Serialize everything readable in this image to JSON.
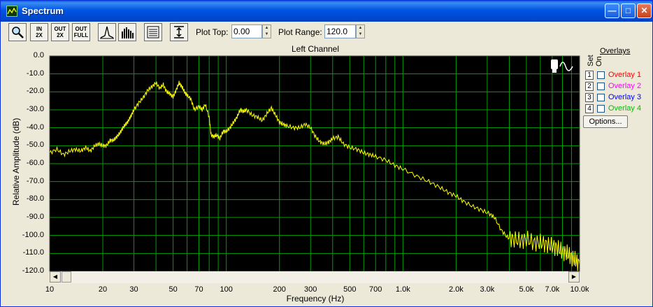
{
  "window": {
    "title": "Spectrum"
  },
  "toolbar": {
    "zoom_in_2x_top": "IN",
    "zoom_in_2x_bottom": "2X",
    "zoom_out_2x_top": "OUT",
    "zoom_out_2x_bottom": "2X",
    "zoom_out_full_top": "OUT",
    "zoom_out_full_bottom": "FULL",
    "plot_top_label": "Plot Top:",
    "plot_top_value": "0.00",
    "plot_range_label": "Plot Range:",
    "plot_range_value": "120.0"
  },
  "overlays": {
    "header": "Overlays",
    "set_label": "Set",
    "on_label": "On",
    "items": [
      {
        "num": "1",
        "name": "Overlay 1",
        "color": "#ff0000",
        "checked": false
      },
      {
        "num": "2",
        "name": "Overlay 2",
        "color": "#ff00ff",
        "checked": false
      },
      {
        "num": "3",
        "name": "Overlay 3",
        "color": "#0000ff",
        "checked": false
      },
      {
        "num": "4",
        "name": "Overlay 4",
        "color": "#00c000",
        "checked": false
      }
    ],
    "options_label": "Options..."
  },
  "colors": {
    "plot_bg": "#000000",
    "grid": "#00a000",
    "trace": "#ffff00",
    "titlebar": "#0054e3"
  },
  "chart_data": {
    "type": "line",
    "title": "Left Channel",
    "xlabel": "Frequency (Hz)",
    "ylabel": "Relative Amplitude (dB)",
    "x_scale": "log",
    "xlim": [
      10,
      10000
    ],
    "ylim": [
      -120,
      0
    ],
    "grid": true,
    "x_tick_labels": [
      {
        "value": 10,
        "label": "10"
      },
      {
        "value": 20,
        "label": "20"
      },
      {
        "value": 30,
        "label": "30"
      },
      {
        "value": 50,
        "label": "50"
      },
      {
        "value": 70,
        "label": "70"
      },
      {
        "value": 100,
        "label": "100"
      },
      {
        "value": 200,
        "label": "200"
      },
      {
        "value": 300,
        "label": "300"
      },
      {
        "value": 500,
        "label": "500"
      },
      {
        "value": 700,
        "label": "700"
      },
      {
        "value": 1000,
        "label": "1.0k"
      },
      {
        "value": 2000,
        "label": "2.0k"
      },
      {
        "value": 3000,
        "label": "3.0k"
      },
      {
        "value": 5000,
        "label": "5.0k"
      },
      {
        "value": 7000,
        "label": "7.0k"
      },
      {
        "value": 10000,
        "label": "10.0k"
      }
    ],
    "y_tick_labels": [
      {
        "value": 0,
        "label": "0.0"
      },
      {
        "value": -10,
        "label": "-10.0"
      },
      {
        "value": -20,
        "label": "-20.0"
      },
      {
        "value": -30,
        "label": "-30.0"
      },
      {
        "value": -40,
        "label": "-40.0"
      },
      {
        "value": -50,
        "label": "-50.0"
      },
      {
        "value": -60,
        "label": "-60.0"
      },
      {
        "value": -70,
        "label": "-70.0"
      },
      {
        "value": -80,
        "label": "-80.0"
      },
      {
        "value": -90,
        "label": "-90.0"
      },
      {
        "value": -100,
        "label": "-100.0"
      },
      {
        "value": -110,
        "label": "-110.0"
      },
      {
        "value": -120,
        "label": "-120.0"
      }
    ],
    "series": [
      {
        "color": "#ffff00",
        "points": [
          [
            10,
            -54
          ],
          [
            11,
            -52
          ],
          [
            12,
            -55
          ],
          [
            13,
            -53
          ],
          [
            14,
            -52
          ],
          [
            15,
            -53
          ],
          [
            16,
            -51
          ],
          [
            17,
            -53
          ],
          [
            18,
            -50
          ],
          [
            19,
            -49
          ],
          [
            20,
            -50
          ],
          [
            21,
            -50
          ],
          [
            22,
            -47
          ],
          [
            23,
            -47
          ],
          [
            24,
            -45
          ],
          [
            25,
            -43
          ],
          [
            26,
            -40
          ],
          [
            27,
            -38
          ],
          [
            28,
            -36
          ],
          [
            29,
            -33
          ],
          [
            30,
            -30
          ],
          [
            32,
            -26
          ],
          [
            34,
            -23
          ],
          [
            36,
            -19
          ],
          [
            38,
            -17
          ],
          [
            40,
            -15
          ],
          [
            42,
            -18
          ],
          [
            44,
            -16
          ],
          [
            46,
            -20
          ],
          [
            48,
            -21
          ],
          [
            50,
            -23
          ],
          [
            52,
            -19
          ],
          [
            54,
            -15
          ],
          [
            56,
            -17
          ],
          [
            58,
            -20
          ],
          [
            60,
            -22
          ],
          [
            63,
            -24
          ],
          [
            66,
            -30
          ],
          [
            70,
            -28
          ],
          [
            73,
            -30
          ],
          [
            76,
            -27
          ],
          [
            80,
            -34
          ],
          [
            82,
            -44
          ],
          [
            85,
            -45
          ],
          [
            88,
            -44
          ],
          [
            92,
            -46
          ],
          [
            96,
            -42
          ],
          [
            100,
            -42
          ],
          [
            105,
            -40
          ],
          [
            110,
            -37
          ],
          [
            115,
            -34
          ],
          [
            120,
            -30
          ],
          [
            125,
            -31
          ],
          [
            130,
            -30
          ],
          [
            140,
            -33
          ],
          [
            150,
            -34
          ],
          [
            160,
            -36
          ],
          [
            170,
            -32
          ],
          [
            180,
            -29
          ],
          [
            190,
            -33
          ],
          [
            200,
            -37
          ],
          [
            210,
            -38
          ],
          [
            220,
            -39
          ],
          [
            240,
            -40
          ],
          [
            260,
            -40
          ],
          [
            280,
            -38
          ],
          [
            300,
            -40
          ],
          [
            320,
            -45
          ],
          [
            340,
            -48
          ],
          [
            360,
            -49
          ],
          [
            380,
            -48
          ],
          [
            400,
            -46
          ],
          [
            430,
            -45
          ],
          [
            460,
            -49
          ],
          [
            500,
            -51
          ],
          [
            550,
            -52
          ],
          [
            600,
            -54
          ],
          [
            650,
            -55
          ],
          [
            700,
            -56
          ],
          [
            800,
            -58
          ],
          [
            900,
            -61
          ],
          [
            1000,
            -63
          ],
          [
            1200,
            -67
          ],
          [
            1400,
            -70
          ],
          [
            1600,
            -73
          ],
          [
            1800,
            -76
          ],
          [
            2000,
            -78
          ],
          [
            2200,
            -81
          ],
          [
            2500,
            -84
          ],
          [
            2800,
            -86
          ],
          [
            3100,
            -88
          ],
          [
            3300,
            -90
          ],
          [
            3600,
            -97
          ],
          [
            3900,
            -101
          ],
          [
            4200,
            -102
          ],
          [
            4600,
            -103
          ],
          [
            5000,
            -102
          ],
          [
            5500,
            -104
          ],
          [
            6000,
            -104
          ],
          [
            6500,
            -105
          ],
          [
            7000,
            -106
          ],
          [
            7500,
            -107
          ],
          [
            8000,
            -109
          ],
          [
            8500,
            -110
          ],
          [
            9000,
            -112
          ],
          [
            9500,
            -114
          ],
          [
            10000,
            -116
          ]
        ]
      }
    ]
  }
}
